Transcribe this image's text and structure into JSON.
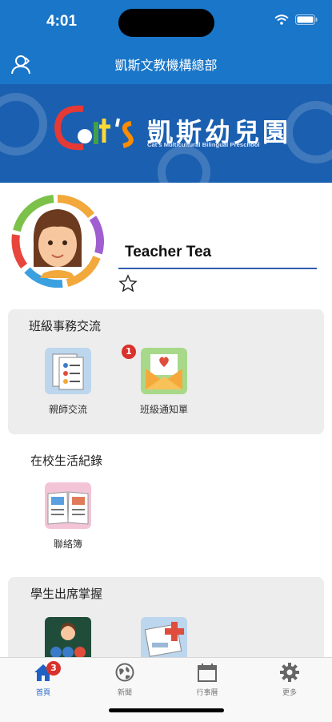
{
  "status_bar": {
    "time": "4:01"
  },
  "nav": {
    "title": "凱斯文教機構總部"
  },
  "banner": {
    "logo_text": "Cat's",
    "name_cn": "凱斯幼兒園",
    "name_en": "Cat's Multicultural Bilingual Preschool"
  },
  "profile": {
    "name": "Teacher Tea"
  },
  "sections": [
    {
      "title": "班級事務交流",
      "items": [
        {
          "label": "親師交流"
        },
        {
          "label": "班級通知單",
          "badge": "1"
        }
      ]
    },
    {
      "title": "在校生活紀錄",
      "items": [
        {
          "label": "聯絡簿"
        }
      ]
    },
    {
      "title": "學生出席掌握"
    }
  ],
  "tabbar": {
    "items": [
      {
        "label": "首頁",
        "badge": "3",
        "active": true
      },
      {
        "label": "新聞"
      },
      {
        "label": "行事曆"
      },
      {
        "label": "更多"
      }
    ]
  },
  "colors": {
    "header_blue": "#1976c8",
    "accent_blue": "#1e63c4",
    "badge_red": "#d9312c"
  }
}
